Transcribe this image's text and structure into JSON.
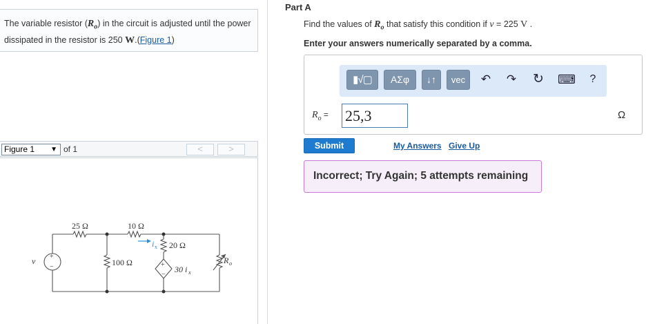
{
  "problem": {
    "text_before": "The variable resistor (",
    "symbol": "R",
    "subscript": "o",
    "text_middle": ") in the circuit is adjusted until the power dissipated in the resistor is 250 ",
    "unit": "W",
    "text_after": ".",
    "figure_link": "Figure 1",
    "link_open": "(",
    "link_close": ")"
  },
  "figure_nav": {
    "selected": "Figure 1",
    "of_text": "of 1",
    "prev": "<",
    "next": ">"
  },
  "circuit": {
    "source": "v",
    "plus": "+",
    "minus": "−",
    "r1": "25 Ω",
    "r2": "10 Ω",
    "r3": "100 Ω",
    "r4": "20 Ω",
    "ix": "i",
    "ix_sub": "x",
    "dep": "30 i",
    "dep_sub": "x",
    "ro": "R",
    "ro_sub": "o"
  },
  "part": {
    "title": "Part A",
    "question_before": "Find the values of ",
    "question_symbol": "R",
    "question_sub": "o",
    "question_mid": " that satisfy this condition if ",
    "question_var": "v",
    "question_eq": " = 225 ",
    "question_unit": "V",
    "question_end": " .",
    "instruction": "Enter your answers numerically separated by a comma."
  },
  "toolbar": {
    "templates": "▮√▢",
    "greek": "ΑΣφ",
    "arrows": "↓↑",
    "vec": "vec",
    "undo": "↶",
    "redo": "↷",
    "reset": "↻",
    "keyboard": "⌨",
    "help": "?"
  },
  "answer": {
    "label_symbol": "R",
    "label_sub": "o",
    "label_eq": " = ",
    "value": "25,3",
    "unit": "Ω"
  },
  "actions": {
    "submit": "Submit",
    "my_answers": "My Answers",
    "give_up": "Give Up"
  },
  "feedback": {
    "message": "Incorrect; Try Again; 5 attempts remaining"
  },
  "colors": {
    "submit": "#1f7bd0",
    "toolbar_bg": "#dce9f9",
    "toolbar_btn": "#7f94ad",
    "feedback_bg": "#f6eef8",
    "feedback_border": "#c679d6",
    "ix_arrow": "#2a8fd8"
  }
}
